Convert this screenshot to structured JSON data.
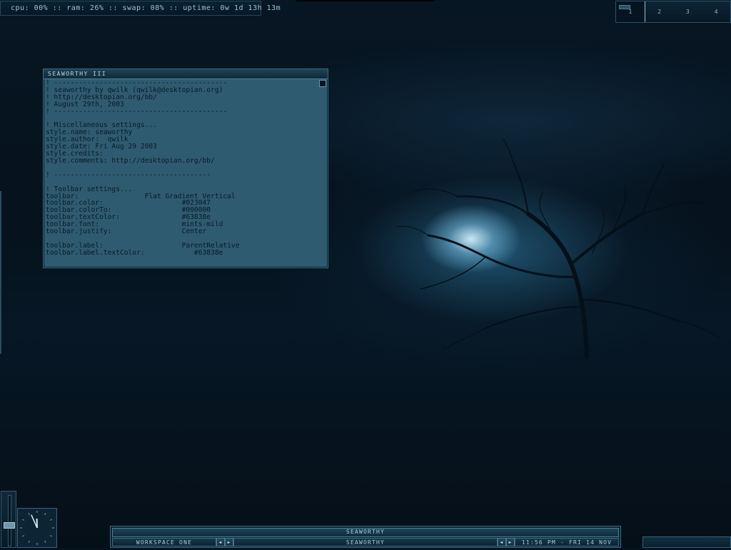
{
  "sysbar": {
    "text": "cpu: 00% :: ram: 26% :: swap: 08% :: uptime: 0w 1d 13h 13m"
  },
  "pager": {
    "workspaces": [
      "1",
      "2",
      "3",
      "4"
    ],
    "active_index": 0
  },
  "window": {
    "title": "seaworthy  ııı",
    "content": "! ------------------------------------------\n! seaworthy by qwilk (qwilk@desktopian.org)\n! http://desktopian.org/bb/\n! August 29th, 2003\n! ------------------------------------------\n\n! Miscellaneous settings...\nstyle.name: seaworthy\nstyle.author:  qwilk\nstyle.date: Fri Aug 29 2003\nstyle.credits:\nstyle.comments: http://desktopian.org/bb/\n\n! --------------------------------------\n\n! Toolbar settings...\ntoolbar:                Flat Gradient Vertical\ntoolbar.color:                   #023047\ntoolbar.colorTo:                 #000000\ntoolbar.textColor:               #63838e\ntoolbar.font:                    mints-mild\ntoolbar.justify:                 Center\n\ntoolbar.label:                   ParentRelative\ntoolbar.label.textColor:            #63838e"
  },
  "toolbar": {
    "top_label": "seaworthy",
    "workspace_label": "workspace one",
    "window_label": "seaworthy",
    "clock_label": "11:56 pm - fri 14 nov",
    "prev_icon": "left-arrow",
    "next_icon": "right-arrow"
  },
  "clock": {
    "hour": 11,
    "minute": 56
  },
  "volume": {
    "level_fraction": 0.4
  },
  "colors": {
    "toolbar_color": "#023047",
    "toolbar_color_to": "#000000",
    "text_color": "#63838e"
  }
}
